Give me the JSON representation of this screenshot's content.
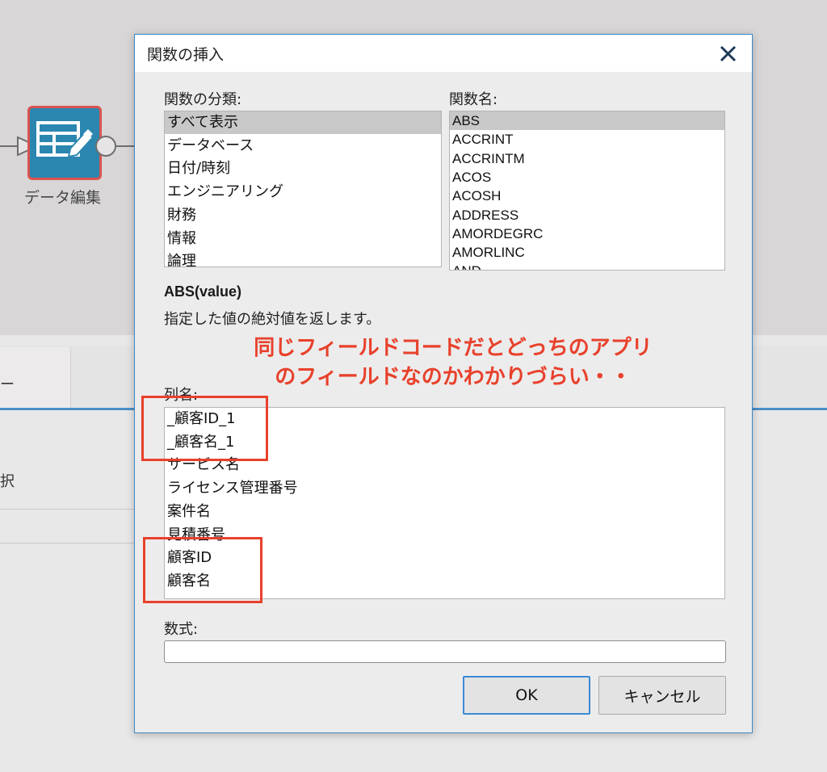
{
  "background": {
    "node_label": "データ編集",
    "tab_label": "ー",
    "row_text": "択"
  },
  "dialog": {
    "title": "関数の挿入",
    "category_label": "関数の分類:",
    "categories": [
      "すべて表示",
      "データベース",
      "日付/時刻",
      "エンジニアリング",
      "財務",
      "情報",
      "論理"
    ],
    "selected_category": "すべて表示",
    "function_label": "関数名:",
    "functions": [
      "ABS",
      "ACCRINT",
      "ACCRINTM",
      "ACOS",
      "ACOSH",
      "ADDRESS",
      "AMORDEGRC",
      "AMORLINC",
      "AND"
    ],
    "selected_function": "ABS",
    "function_signature": "ABS(value)",
    "function_description": "指定した値の絶対値を返します。",
    "column_label": "列名:",
    "columns": [
      "_顧客ID_1",
      "_顧客名_1",
      "サービス名",
      "ライセンス管理番号",
      "案件名",
      "見積番号",
      "顧客ID",
      "顧客名"
    ],
    "formula_label": "数式:",
    "formula_value": "",
    "ok_label": "OK",
    "cancel_label": "キャンセル"
  },
  "annotation": {
    "line1": "同じフィールドコードだとどっちのアプリ",
    "line2": "のフィールドなのかわかりづらい・・",
    "color": "#e8412c"
  },
  "colors": {
    "accent": "#3c88c6",
    "node": "#2b86b0",
    "selection": "#c8c8c8"
  }
}
